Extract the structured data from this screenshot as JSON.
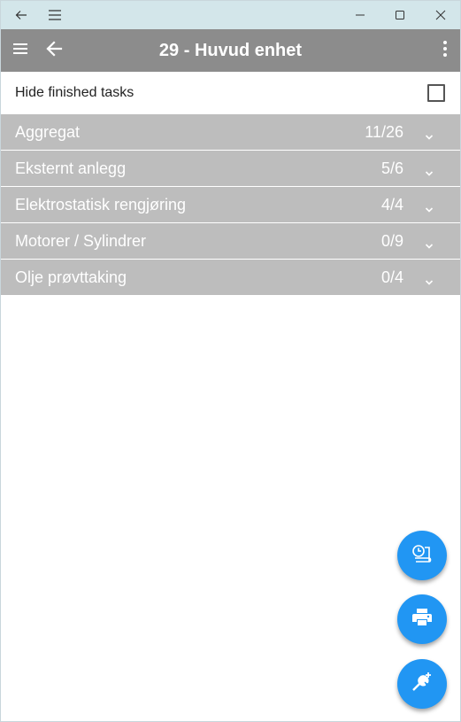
{
  "window": {
    "back_icon": "back-arrow-icon",
    "menu_icon": "hamburger-icon",
    "minimize_icon": "minimize-icon",
    "maximize_icon": "maximize-icon",
    "close_icon": "close-icon"
  },
  "appbar": {
    "title": "29 - Huvud enhet",
    "background": "#8c8c8c",
    "menu_icon": "hamburger-icon",
    "back_icon": "back-arrow-icon",
    "more_icon": "more-vertical-icon"
  },
  "filter": {
    "hide_finished_label": "Hide finished tasks",
    "hide_finished_checked": false
  },
  "groups": [
    {
      "name": "Aggregat",
      "count": "11/26"
    },
    {
      "name": "Eksternt anlegg",
      "count": "5/6"
    },
    {
      "name": "Elektrostatisk rengjøring",
      "count": "4/4"
    },
    {
      "name": "Motorer / Sylindrer",
      "count": "0/9"
    },
    {
      "name": "Olje prøvttaking",
      "count": "0/4"
    }
  ],
  "group_background": "#bdbdbd",
  "fabs": [
    {
      "icon": "timesheet-clock-icon"
    },
    {
      "icon": "print-icon"
    },
    {
      "icon": "add-tool-icon"
    }
  ],
  "accent": "#2196f3"
}
